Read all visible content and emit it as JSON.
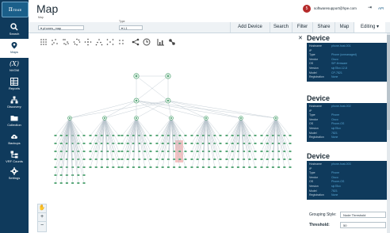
{
  "app": {
    "logo_text": "π",
    "logo_caption": "TIME"
  },
  "sidebar": {
    "items": [
      {
        "label": "Search",
        "icon": "search-icon"
      },
      {
        "label": "Maps",
        "icon": "map-pin-icon",
        "active": true
      },
      {
        "label": "NVGM",
        "icon": "function-icon"
      },
      {
        "label": "Reports",
        "icon": "table-icon"
      },
      {
        "label": "Discovery",
        "icon": "network-icon"
      },
      {
        "label": "Collection",
        "icon": "folder-icon"
      },
      {
        "label": "Backups",
        "icon": "cloud-upload-icon"
      },
      {
        "label": "VRF Counts",
        "icon": "hierarchy-icon"
      },
      {
        "label": "Settings",
        "icon": "gear-icon"
      }
    ]
  },
  "header": {
    "title": "Map",
    "user_badge": "5",
    "user_email": "softwaresupport@hpe.com",
    "api_label": "API"
  },
  "selectors": {
    "map_label": "Map",
    "map_value": "▾ phones_map",
    "type_label": "Type",
    "type_value": "▾ L1"
  },
  "tabs": [
    {
      "label": "Add Device"
    },
    {
      "label": "Search"
    },
    {
      "label": "Filter"
    },
    {
      "label": "Share"
    },
    {
      "label": "Map"
    },
    {
      "label": "Editing ▾",
      "active": true
    }
  ],
  "toolbar": [
    "grid-layout-icon",
    "scatter-layout-icon",
    "cluster-layout-icon",
    "circle-layout-icon",
    "radial-layout-icon",
    "triangle-layout-icon",
    "spread-layout-icon",
    "compact-layout-icon",
    "share-icon",
    "clock-icon",
    "chart-icon",
    "link-icon"
  ],
  "zoom": {
    "pan": "✋",
    "in": "+",
    "out": "−"
  },
  "panels": [
    {
      "title": "Device",
      "rows": [
        {
          "key": "Hostname",
          "value": "phone-host-001"
        },
        {
          "key": "IP",
          "value": ""
        },
        {
          "key": "Type",
          "value": "Phone (unmanaged)"
        },
        {
          "key": "Vendor",
          "value": "Cisco"
        },
        {
          "key": "OS",
          "value": "SIP-firmware"
        },
        {
          "key": "Version",
          "value": "sip78xx.12-8"
        },
        {
          "key": "Model",
          "value": "CP-7821"
        },
        {
          "key": "Registration",
          "value": "None"
        }
      ]
    },
    {
      "title": "Device",
      "rows": [
        {
          "key": "Hostname",
          "value": "phone-host-002"
        },
        {
          "key": "IP",
          "value": ""
        },
        {
          "key": "Type",
          "value": "Phone"
        },
        {
          "key": "Vendor",
          "value": "Cisco"
        },
        {
          "key": "OS",
          "value": "Phone-OS"
        },
        {
          "key": "Version",
          "value": "sip78xx"
        },
        {
          "key": "Model",
          "value": "7821"
        },
        {
          "key": "Registration",
          "value": "None"
        }
      ]
    },
    {
      "title": "Device",
      "rows": [
        {
          "key": "Hostname",
          "value": "phone-host-003"
        },
        {
          "key": "IP",
          "value": ""
        },
        {
          "key": "Type",
          "value": "Phone"
        },
        {
          "key": "Vendor",
          "value": "Cisco"
        },
        {
          "key": "OS",
          "value": "Phone-OS"
        },
        {
          "key": "Version",
          "value": "sip78xx"
        },
        {
          "key": "Model",
          "value": "7821"
        },
        {
          "key": "Registration",
          "value": "None"
        }
      ]
    }
  ],
  "grouping": {
    "style_label": "Grouping Style:",
    "style_value": "Node Threshold",
    "threshold_label": "Threshold:",
    "threshold_value": "50"
  },
  "colors": {
    "sidebar": "#0f3a5c",
    "accent": "#1b5f8a",
    "node": "#5aa87a",
    "highlight": "#f2b3b3",
    "tab_active": "#f3a21a"
  }
}
